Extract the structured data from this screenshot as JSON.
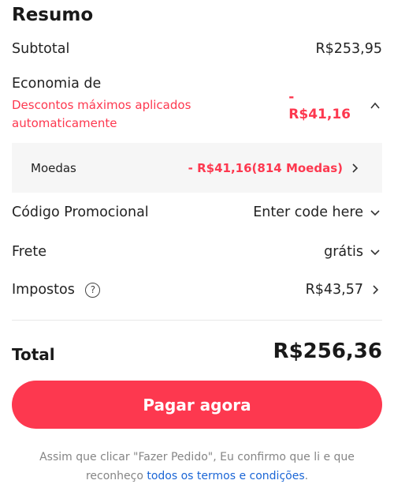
{
  "summary": {
    "title": "Resumo",
    "subtotal": {
      "label": "Subtotal",
      "value": "R$253,95"
    },
    "economy": {
      "label": "Economia de",
      "note": "Descontos máximos aplicados automaticamente",
      "dash": "-",
      "value": "R$41,16"
    },
    "coins": {
      "label": "Moedas",
      "value": "- R$41,16(814 Moedas)"
    },
    "promo": {
      "label": "Código Promocional",
      "value": "Enter code here"
    },
    "shipping": {
      "label": "Frete",
      "value": "grátis"
    },
    "taxes": {
      "label": "Impostos",
      "help": "?",
      "value": "R$43,57"
    },
    "total": {
      "label": "Total",
      "value": "R$256,36"
    },
    "pay_button": "Pagar agora",
    "terms": {
      "text": "Assim que clicar \"Fazer Pedido\", Eu confirmo que li e que reconheço ",
      "link": "todos os termos e condições",
      "end": "."
    }
  },
  "colors": {
    "accent": "#fd384f",
    "link": "#1b66d6",
    "muted": "#858585"
  },
  "icons": [
    "chevron-up-icon",
    "chevron-right-icon",
    "chevron-down-icon",
    "help-circle-icon"
  ]
}
